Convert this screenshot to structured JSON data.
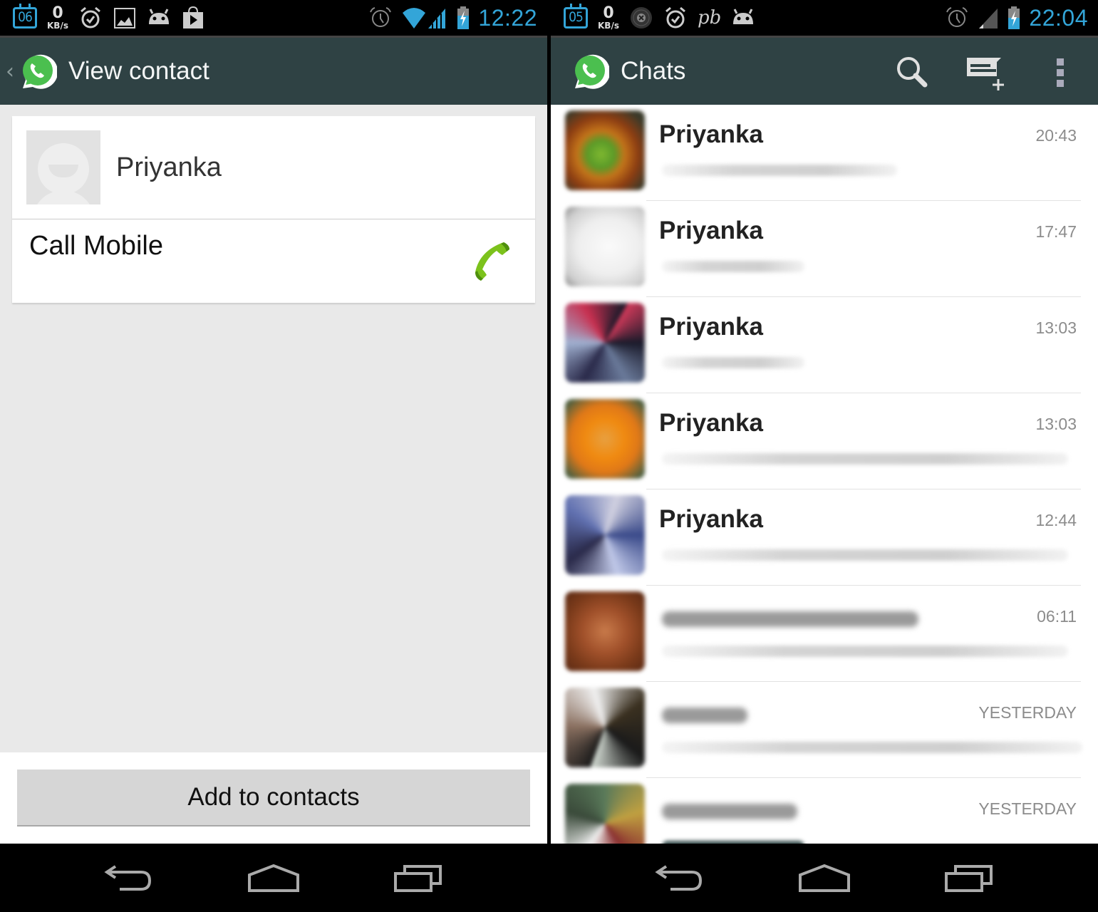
{
  "left_screen": {
    "status_bar": {
      "calendar_day": "06",
      "network_speed_value": "0",
      "network_speed_unit": "KB/s",
      "left_icons": [
        "calendar-icon",
        "network-speed",
        "alarm-clock-icon",
        "image-icon",
        "android-icon",
        "play-store-icon"
      ],
      "right_icons": [
        "alarm-icon",
        "wifi-icon",
        "signal-icon",
        "battery-charging-icon"
      ],
      "time": "12:22"
    },
    "action_bar": {
      "title": "View contact",
      "back_icon": "back-caret-icon",
      "app_icon": "whatsapp-logo"
    },
    "contact_card": {
      "name": "Priyanka",
      "action_label": "Call Mobile",
      "action_icon": "phone-icon"
    },
    "footer": {
      "add_button_label": "Add to contacts"
    }
  },
  "right_screen": {
    "status_bar": {
      "calendar_day": "05",
      "network_speed_value": "0",
      "network_speed_unit": "KB/s",
      "left_icons": [
        "calendar-icon",
        "network-speed",
        "vinyl-record-icon",
        "alarm-clock-icon",
        "pb-icon",
        "android-icon"
      ],
      "right_icons": [
        "alarm-icon",
        "signal-icon",
        "battery-charging-icon"
      ],
      "pb_label": "pb",
      "time": "22:04"
    },
    "action_bar": {
      "title": "Chats",
      "app_icon": "whatsapp-logo",
      "actions": [
        "search-icon",
        "new-chat-icon",
        "overflow-menu-icon"
      ]
    },
    "chats": [
      {
        "name": "Priyanka",
        "time": "20:43",
        "name_hidden": false
      },
      {
        "name": "Priyanka",
        "time": "17:47",
        "name_hidden": false
      },
      {
        "name": "Priyanka",
        "time": "13:03",
        "name_hidden": false
      },
      {
        "name": "Priyanka",
        "time": "13:03",
        "name_hidden": false
      },
      {
        "name": "Priyanka",
        "time": "12:44",
        "name_hidden": false
      },
      {
        "name": "",
        "time": "06:11",
        "name_hidden": true
      },
      {
        "name": "",
        "time": "YESTERDAY",
        "name_hidden": true
      },
      {
        "name": "",
        "time": "YESTERDAY",
        "name_hidden": true
      }
    ]
  },
  "navigation": {
    "buttons": [
      "back",
      "home",
      "recent-apps"
    ]
  },
  "colors": {
    "action_bar": "#2f4244",
    "status_accent": "#33a5d8",
    "whatsapp_green": "#4bbf4f",
    "call_green": "#7cc21c",
    "timestamp_gray": "#8c8c8c"
  }
}
